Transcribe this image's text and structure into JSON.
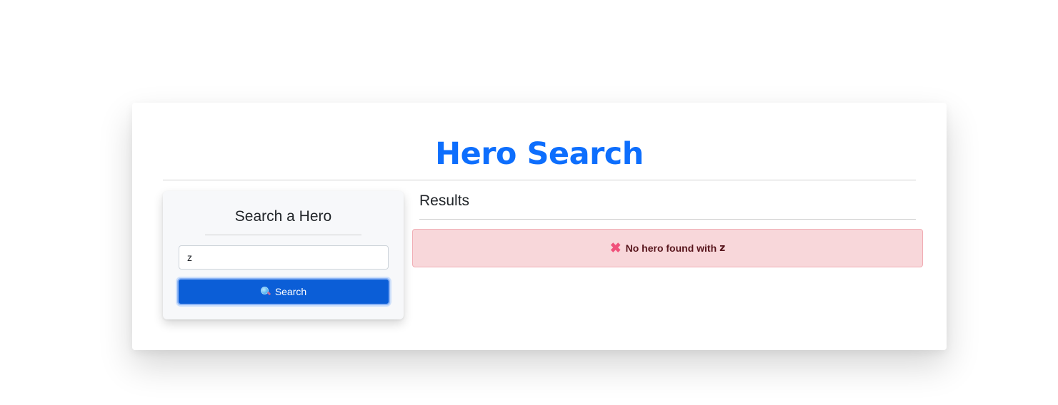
{
  "header": {
    "title": "Hero Search",
    "title_color": "#0d6efd"
  },
  "search_panel": {
    "title": "Search a Hero",
    "input_value": "z",
    "button_label": "Search",
    "button_icon": "magnifying-glass-icon",
    "button_color": "#0b5ed7"
  },
  "results": {
    "title": "Results",
    "alert": {
      "icon": "cross-mark-icon",
      "icon_glyph": "✖",
      "message": "No hero found with",
      "query": "z",
      "background": "#f8d7da",
      "text_color": "#58151c"
    }
  }
}
